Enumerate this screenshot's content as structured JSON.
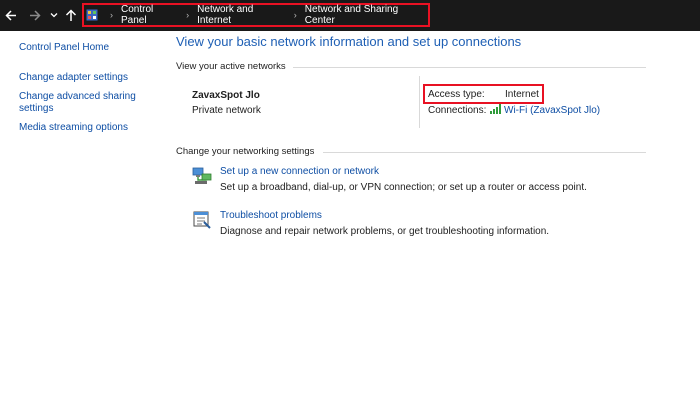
{
  "breadcrumb": {
    "items": [
      "Control Panel",
      "Network and Internet",
      "Network and Sharing Center"
    ],
    "separator": "›"
  },
  "sidebar": {
    "home": "Control Panel Home",
    "links": [
      {
        "line1": "Change adapter settings",
        "line2": ""
      },
      {
        "line1": "Change advanced sharing",
        "line2": "settings"
      },
      {
        "line1": "Media streaming options",
        "line2": ""
      }
    ]
  },
  "main": {
    "title": "View your basic network information and set up connections",
    "active_networks_heading": "View your active networks",
    "network": {
      "name": "ZavaxSpot Jlo",
      "category": "Private network",
      "access_type_label": "Access type:",
      "access_type_value": "Internet",
      "connections_label": "Connections:",
      "connection_name": "Wi-Fi (ZavaxSpot Jlo)"
    },
    "settings_heading": "Change your networking settings",
    "tasks": [
      {
        "icon": "network-setup-icon",
        "link": "Set up a new connection or network",
        "desc": "Set up a broadband, dial-up, or VPN connection; or set up a router or access point."
      },
      {
        "icon": "troubleshoot-icon",
        "link": "Troubleshoot problems",
        "desc": "Diagnose and repair network problems, or get troubleshooting information."
      }
    ]
  },
  "colors": {
    "highlight_border": "#e81123",
    "link": "#0e4ea4",
    "title": "#1e5fb4",
    "topbar": "#191919"
  }
}
